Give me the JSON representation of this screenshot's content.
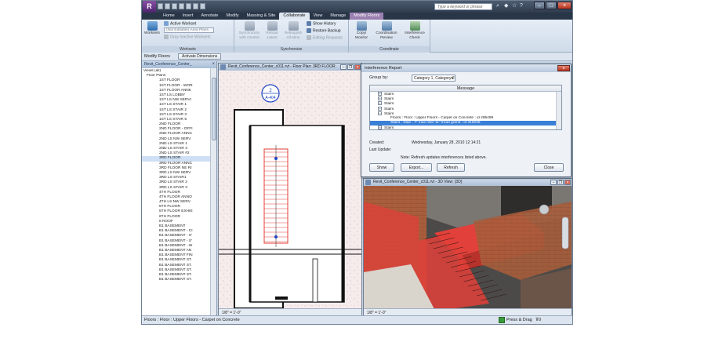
{
  "qat_items": [
    "open",
    "save",
    "undo",
    "redo",
    "print",
    "measure",
    "sync"
  ],
  "search": {
    "placeholder": "Type a keyword or phrase"
  },
  "tabs": [
    "Home",
    "Insert",
    "Annotate",
    "Modify",
    "Massing & Site",
    "Collaborate",
    "View",
    "Manage",
    "Modify Floors"
  ],
  "active_tab": "Collaborate",
  "ribbon": {
    "worksets_panel": {
      "title": "Worksets",
      "worksets_button": "Worksets",
      "active_workset_label": "Active Workset",
      "active_workset_value": "(Not Editable) Area Plans",
      "gray_inactive": "Gray Inactive Worksets"
    },
    "synchronize_panel": {
      "title": "Synchronize",
      "sync_central": "Synchronize with Central",
      "reload_latest": "Reload Latest",
      "relinquish_all": "Relinquish All Mine",
      "show_history": "Show History",
      "restore_backup": "Restore Backup",
      "editing_requests": "Editing Requests"
    },
    "coordination_panel": {
      "title": "Coordinate",
      "copy_monitor": "Copy/ Monitor",
      "coordination_review": "Coordination Review",
      "interference_check": "Interference Check"
    }
  },
  "options_bar": {
    "label": "Modify Floors",
    "button": "Activate Dimensions"
  },
  "project_browser": {
    "title": "Revit_Conference_Center_",
    "items": [
      "Views (all)",
      "Floor Plans",
      "1ST FLOOR",
      "1ST FLOOR - WOR",
      "1ST FLOOR ANNK",
      "1ST LS LOBBY",
      "1ST LS NW SERVI",
      "1ST LS STAIR 1",
      "1ST LS STAIR 2",
      "1ST LS STAIR 3",
      "1ST LS STAIR 5",
      "2ND FLOOR",
      "2ND FLOOR - OFFI",
      "2ND FLOOR ANNC",
      "2ND LS NW SERV",
      "2ND LS STAIR 1",
      "2ND LS STAIR 3",
      "2ND LS STAIR #2",
      "3RD FLOOR",
      "3RD FLOOR ANNC",
      "3RD FLOOR NE RI",
      "3RD LS NW SERV",
      "3RD LS STAIR1",
      "3RD LS STAIR 2",
      "3RD LS STAIR 3",
      "4TH FLOOR",
      "4TH FLOOR ANNO",
      "4TH LS NW SERV",
      "5TH FLOOR",
      "5TH FLOOR EXHIE",
      "6TH FLOOR",
      "8 ROOF",
      "B1 BASEMENT",
      "B1 BASEMENT - CI",
      "B1 BASEMENT - S'",
      "B1 BASEMENT - S'",
      "B1 BASEMENT - W",
      "B1 BASEMENT AN",
      "B1 BASEMENT FIN",
      "B1 BASEMENT ST.",
      "B1 BASEMENT ST.",
      "B1 BASEMENT ST.",
      "B1 BASEMENT ST.",
      "B1 BASEMENT ST."
    ],
    "selected": "3RD FLOOR"
  },
  "floor_plan_view": {
    "title": "Revit_Conference_Center_c011.rvt - Floor Plan: 3RD FLOOR",
    "tag_number": "2",
    "tag_sheet": "A-404",
    "scale": "1/8\" = 1'-0\""
  },
  "view3d": {
    "title": "Revit_Conference_Center_c011.rvt - 3D View: {3D}",
    "scale": "1/8\" = 1'-0\""
  },
  "dialog": {
    "title": "Interference Report",
    "group_by_label": "Group by:",
    "group_by_value": "Category 1, Category 2",
    "column_header": "Message",
    "rows": [
      {
        "level": 1,
        "text": "Stairs"
      },
      {
        "level": 1,
        "text": "Stairs"
      },
      {
        "level": 1,
        "text": "Stairs"
      },
      {
        "level": 1,
        "text": "Stairs"
      },
      {
        "level": 1,
        "text": "Stairs"
      },
      {
        "level": 2,
        "text": "Floors : Floor : Upper Floors - Carpet on Concrete : id 285499"
      },
      {
        "level": 2,
        "text": "Stairs : Stair : 7\" max riser 11\" tread grand : id 316245"
      },
      {
        "level": 1,
        "text": "Stairs"
      },
      {
        "level": 1,
        "text": "Stairs"
      }
    ],
    "highlight_row": 6,
    "created_label": "Created:",
    "created_value": "Wednesday, January 28, 2010 12:14:21",
    "last_update_label": "Last Update:",
    "note": "Note: Refresh updates interferences listed above.",
    "buttons": {
      "show": "Show",
      "export": "Export...",
      "refresh": "Refresh",
      "close": "Close"
    }
  },
  "status_bar": {
    "text": "Floors : Floor : Upper Floors - Carpet on Concrete",
    "press_drag": "Press & Drag",
    "filter_count": "0"
  },
  "colors": {
    "interference_highlight": "#e2403a",
    "selection_blue": "#3a7fd6",
    "title_dark": "#2f3c4e"
  }
}
